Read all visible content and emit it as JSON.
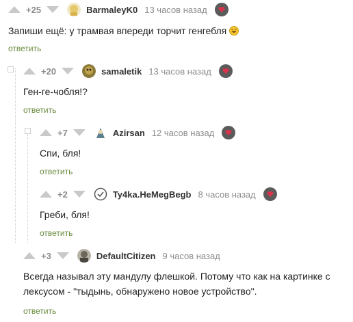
{
  "comments": [
    {
      "rating": "+25",
      "username": "BarmaleyK0",
      "time": "13 часов назад",
      "text": "Запиши ещё: у трамвая впереди торчит генгебля",
      "reply": "ответить"
    },
    {
      "rating": "+20",
      "username": "samaletik",
      "time": "13 часов назад",
      "text": "Ген-ге-чобля!?",
      "reply": "ответить"
    },
    {
      "rating": "+7",
      "username": "Azirsan",
      "time": "12 часов назад",
      "text": "Спи, бля!",
      "reply": "ответить"
    },
    {
      "rating": "+2",
      "username": "Ty4ka.HeMegBegb",
      "time": "8 часов назад",
      "text": "Греби, бля!",
      "reply": "ответить"
    },
    {
      "rating": "+3",
      "username": "DefaultCitizen",
      "time": "9 часов назад",
      "text_line1": "Всегда называл эту мандулу флешкой. Потому что как на картинке с",
      "text_line2": "лексусом - \"тыдынь, обнаружено новое устройство\".",
      "reply": "ответить"
    }
  ],
  "colors": {
    "reply": "#6a8c3f",
    "rating": "#8c8c8c",
    "arrow": "#c9c9c9"
  }
}
